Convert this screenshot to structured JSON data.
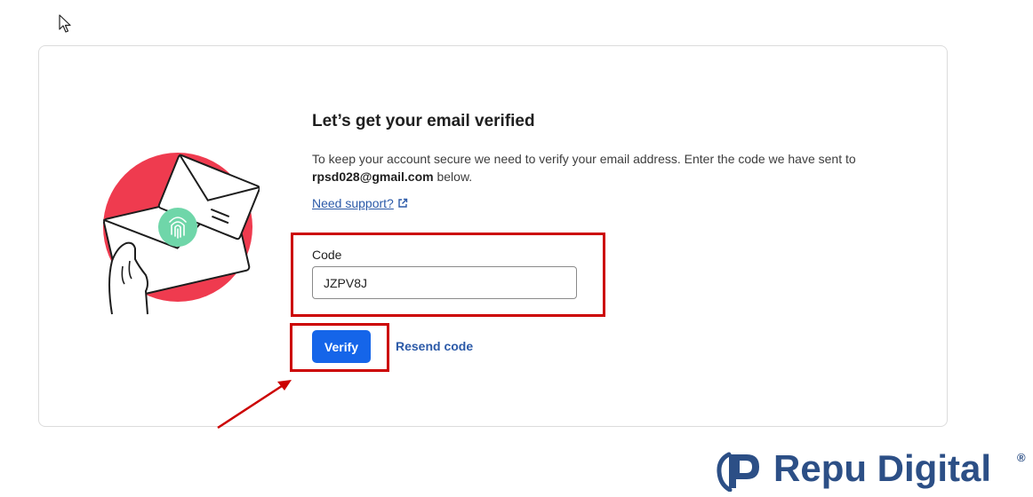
{
  "page": {
    "title": "Let’s get your email verified",
    "description_before": "To keep your account secure we need to verify your email address. Enter the code we have sent to ",
    "email": "rpsd028@gmail.com",
    "description_after": " below.",
    "support_link": "Need support?"
  },
  "form": {
    "code_label": "Code",
    "code_value": "JZPV8J",
    "verify_label": "Verify",
    "resend_label": "Resend code"
  },
  "watermark": {
    "brand_text": "Repu Digital",
    "registered_mark": "®"
  },
  "colors": {
    "accent_blue": "#1565e9",
    "link_blue": "#2c5aa8",
    "highlight_red": "#cc0000",
    "illustration_red": "#ef3b4f",
    "fingerprint_green": "#6fd6a9",
    "brand_navy": "#2c4f86"
  }
}
